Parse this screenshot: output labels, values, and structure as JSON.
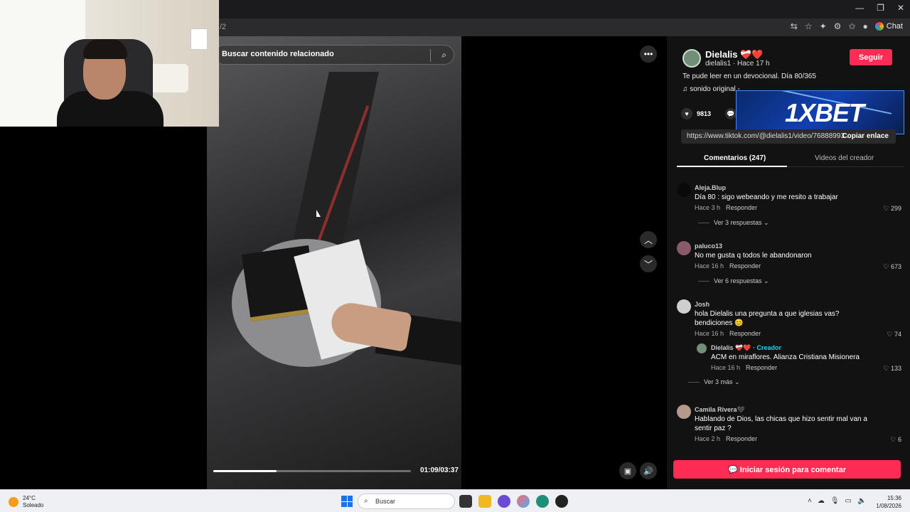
{
  "browser": {
    "url_fragment": "/2",
    "chat_label": "Chat",
    "window_controls": [
      "—",
      "❐",
      "✕"
    ]
  },
  "video": {
    "search_placeholder": "Buscar contenido relacionado",
    "timecode": "01:09/03:37",
    "progress_fraction": 0.32,
    "more_icon": "•••",
    "nav_up_icon": "︿",
    "nav_down_icon": "﹀"
  },
  "author": {
    "name": "Dielalis ❤️‍🩹❤️",
    "sub": "dielalis1 · Hace 17 h",
    "follow_label": "Seguir",
    "description": "Te pude leer en un devocional. Día 80/365",
    "sound": "♫  sonido original - ",
    "likes": "9813"
  },
  "ad": {
    "text": "1XBET"
  },
  "share": {
    "url": "https://www.tiktok.com/@dielalis1/video/76888993...",
    "copy_label": "Copiar enlace"
  },
  "tabs": {
    "comments": "Comentarios (247)",
    "creator_videos": "Videos del creador"
  },
  "comments": [
    {
      "user": "Aleja.Blup",
      "text": "Día 80 : sigo webeando y me resito a trabajar",
      "time": "Hace 3 h",
      "reply": "Responder",
      "likes": "299",
      "more": "Ver 3 respuestas ⌄"
    },
    {
      "user": "paluco13",
      "text": "No me gusta q todos le abandonaron",
      "time": "Hace 16 h",
      "reply": "Responder",
      "likes": "673",
      "more": "Ver 6 respuestas ⌄"
    },
    {
      "user": "Josh",
      "text": "hola Dielalis una pregunta a que iglesias vas? bendiciones 😊",
      "time": "Hace 16 h",
      "reply": "Responder",
      "likes": "74"
    },
    {
      "user": "Camila Rivera🖤",
      "text": "Hablando de Dios, las chicas que hizo sentir mal van a sentir paz ?",
      "time": "Hace 2 h",
      "reply": "Responder",
      "likes": "6"
    }
  ],
  "creator_reply": {
    "user": "Dielalis ❤️‍🩹❤️",
    "tag": "· Creador",
    "text": "ACM en miraflores. Alianza Cristiana Misionera",
    "time": "Hace 16 h",
    "reply": "Responder",
    "likes": "133",
    "more": "Ver 3 más ⌄"
  },
  "login_label": "Iniciar sesión para comentar",
  "taskbar": {
    "temp": "24°C",
    "weather": "Soleado",
    "search_placeholder": "Buscar",
    "time": "15:36",
    "date": "1/08/2026"
  },
  "colors": {
    "accent": "#fe2c55",
    "creator_tag": "#20d5ec",
    "panel_bg": "#121212"
  }
}
